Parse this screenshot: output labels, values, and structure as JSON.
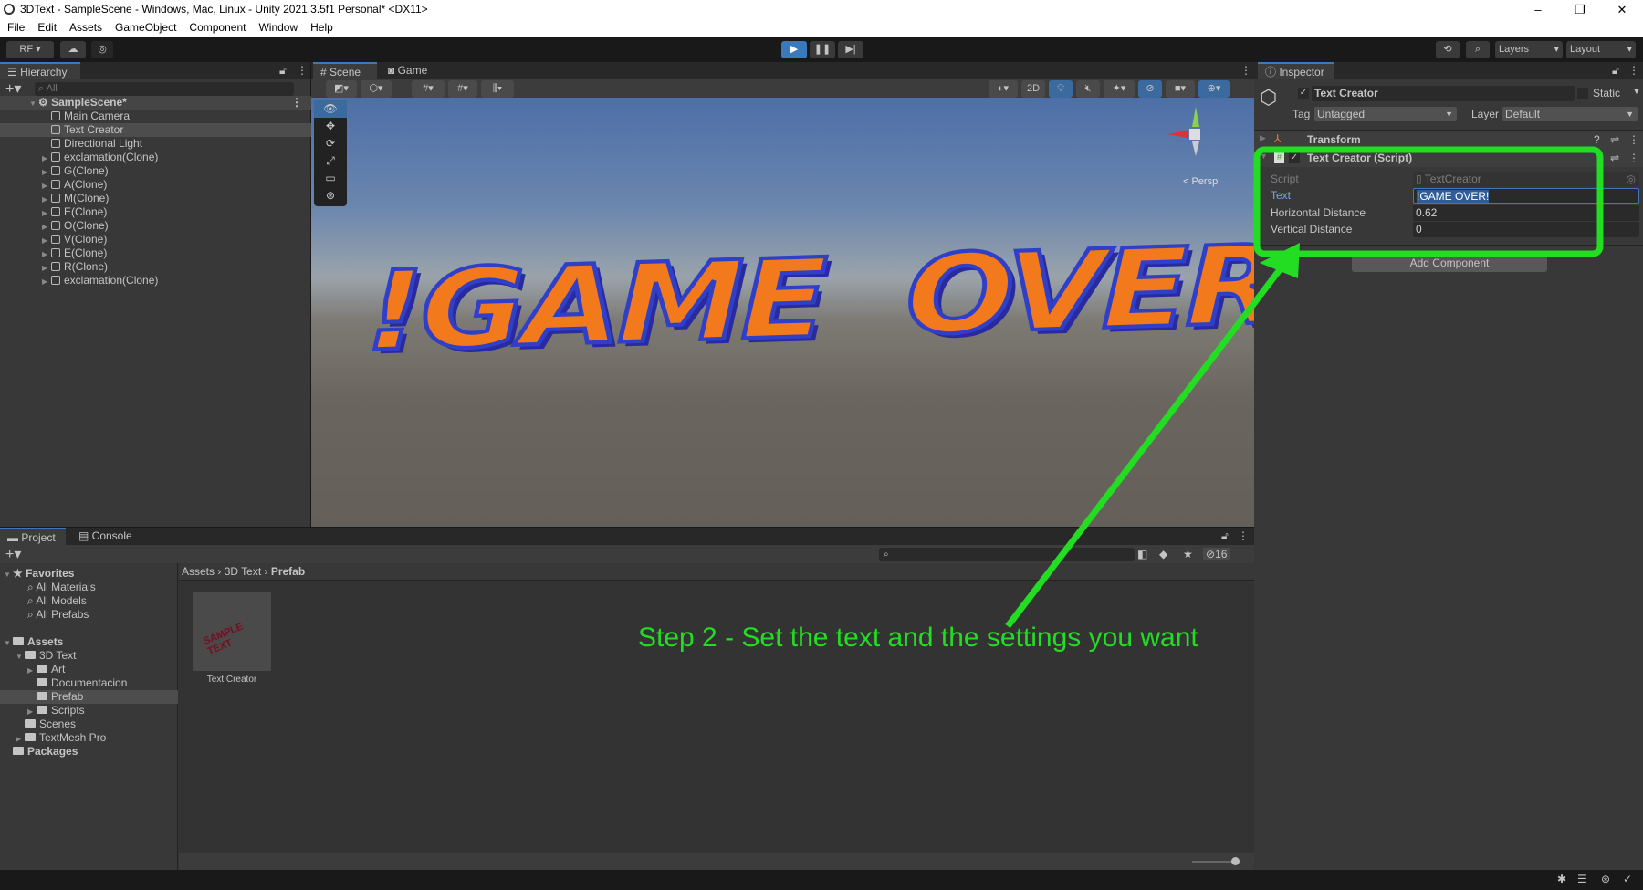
{
  "window": {
    "title": "3DText - SampleScene - Windows, Mac, Linux - Unity 2021.3.5f1 Personal* <DX11>",
    "controls": [
      "–",
      "❐",
      "✕"
    ]
  },
  "menu": [
    "File",
    "Edit",
    "Assets",
    "GameObject",
    "Component",
    "Window",
    "Help"
  ],
  "toolbar": {
    "account": "RF ▾",
    "layers": "Layers",
    "layout": "Layout"
  },
  "hierarchy": {
    "tab": "Hierarchy",
    "search_placeholder": "All",
    "scene": "SampleScene*",
    "items": [
      {
        "label": "Main Camera",
        "expandable": false,
        "selected": false
      },
      {
        "label": "Text Creator",
        "expandable": false,
        "selected": true
      },
      {
        "label": "Directional Light",
        "expandable": false,
        "selected": false
      },
      {
        "label": "exclamation(Clone)",
        "expandable": true,
        "selected": false
      },
      {
        "label": "G(Clone)",
        "expandable": true,
        "selected": false
      },
      {
        "label": "A(Clone)",
        "expandable": true,
        "selected": false
      },
      {
        "label": "M(Clone)",
        "expandable": true,
        "selected": false
      },
      {
        "label": "E(Clone)",
        "expandable": true,
        "selected": false
      },
      {
        "label": "O(Clone)",
        "expandable": true,
        "selected": false
      },
      {
        "label": "V(Clone)",
        "expandable": true,
        "selected": false
      },
      {
        "label": "E(Clone)",
        "expandable": true,
        "selected": false
      },
      {
        "label": "R(Clone)",
        "expandable": true,
        "selected": false
      },
      {
        "label": "exclamation(Clone)",
        "expandable": true,
        "selected": false
      }
    ]
  },
  "scene": {
    "tabs": [
      "Scene",
      "Game"
    ],
    "btn_2d": "2D",
    "persp": "< Persp",
    "rendered_text": "!GAME  OVER!"
  },
  "inspector": {
    "tab": "Inspector",
    "object_name": "Text Creator",
    "static_label": "Static",
    "tag_label": "Tag",
    "tag_value": "Untagged",
    "layer_label": "Layer",
    "layer_value": "Default",
    "transform": "Transform",
    "component": "Text Creator (Script)",
    "fields": [
      {
        "label": "Script",
        "value": "TextCreator"
      },
      {
        "label": "Text",
        "value": "!GAME OVER!"
      },
      {
        "label": "Horizontal Distance",
        "value": "0.62"
      },
      {
        "label": "Vertical Distance",
        "value": "0"
      }
    ],
    "add_component": "Add Component"
  },
  "project": {
    "tabs": [
      "Project",
      "Console"
    ],
    "hidden_count": "16",
    "favorites": {
      "label": "Favorites",
      "items": [
        "All Materials",
        "All Models",
        "All Prefabs"
      ]
    },
    "tree": [
      {
        "label": "Assets",
        "depth": 0,
        "arrow": "▼",
        "bold": true
      },
      {
        "label": "3D Text",
        "depth": 1,
        "arrow": "▼"
      },
      {
        "label": "Art",
        "depth": 2,
        "arrow": "▶"
      },
      {
        "label": "Documentacion",
        "depth": 2,
        "arrow": ""
      },
      {
        "label": "Prefab",
        "depth": 2,
        "arrow": "",
        "selected": true
      },
      {
        "label": "Scripts",
        "depth": 2,
        "arrow": "▶"
      },
      {
        "label": "Scenes",
        "depth": 1,
        "arrow": ""
      },
      {
        "label": "TextMesh Pro",
        "depth": 1,
        "arrow": "▶"
      },
      {
        "label": "Packages",
        "depth": 0,
        "arrow": "",
        "bold": true
      }
    ],
    "breadcrumb": [
      "Assets",
      "3D Text",
      "Prefab"
    ],
    "asset": {
      "label": "Text Creator",
      "thumb_text": "SAMPLE TEXT"
    }
  },
  "annotation": {
    "text": "Step 2 - Set the text and the settings you want",
    "color": "#22dd22"
  }
}
